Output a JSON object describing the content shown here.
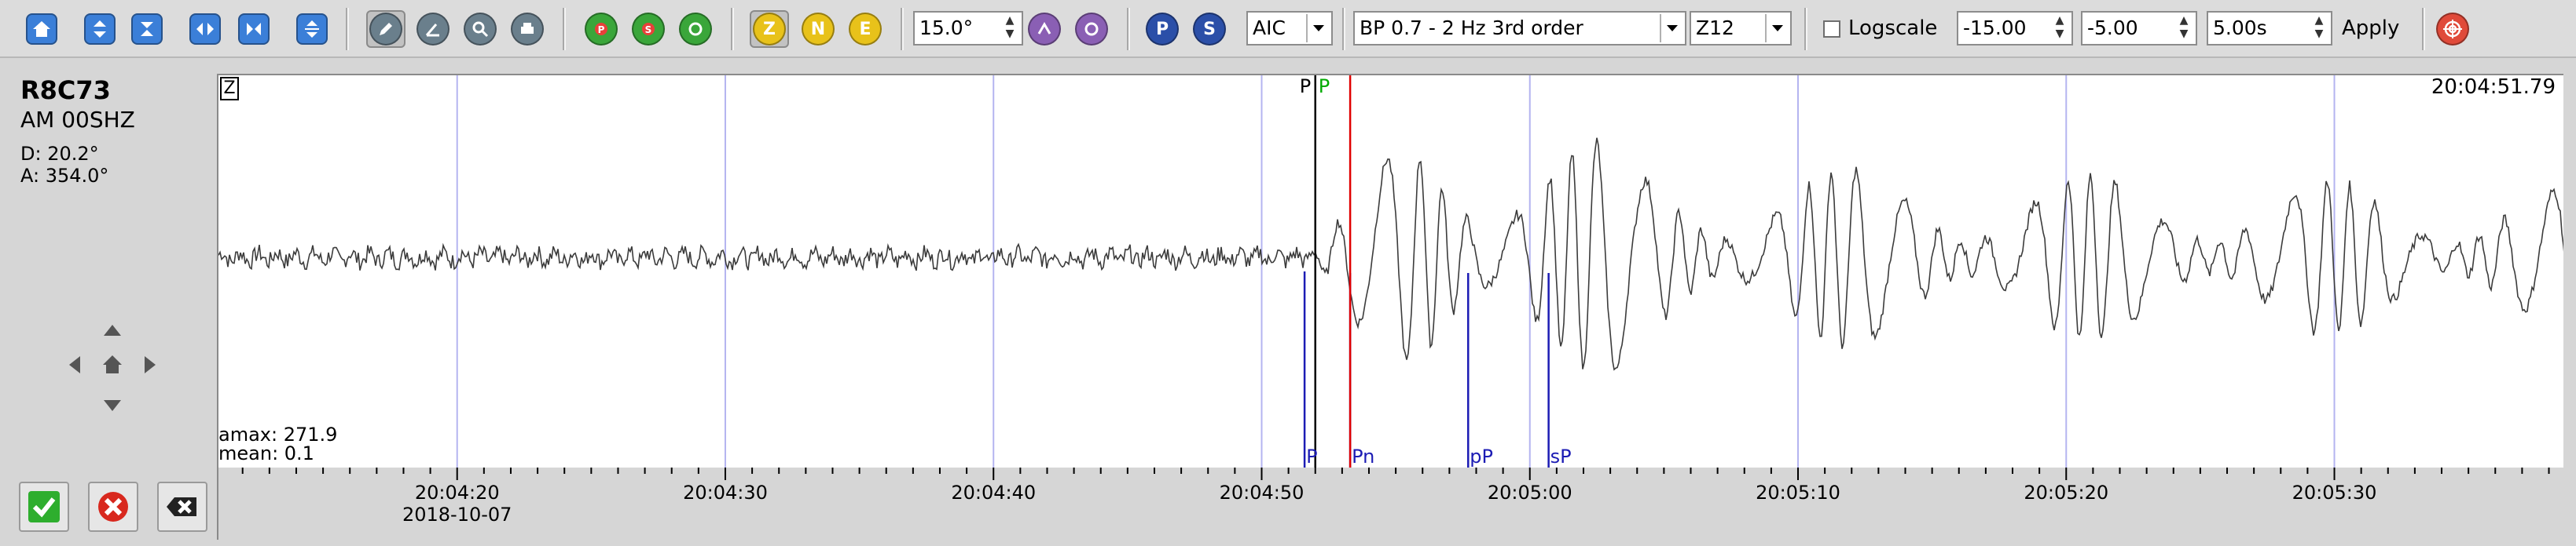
{
  "toolbar": {
    "filter_angle": "15.0°",
    "method": "AIC",
    "filter": "BP 0.7 - 2 Hz  3rd order",
    "component": "Z12",
    "logscale_label": "Logscale",
    "min_offset": "-15.00",
    "max_offset": "-5.00",
    "window_length": "5.00s",
    "apply_label": "Apply",
    "comp_z": "Z",
    "comp_n": "N",
    "comp_e": "E",
    "pick_p": "P",
    "pick_s": "S"
  },
  "station": {
    "code": "R8C73",
    "stream": "AM  00SHZ",
    "distance": "D:  20.2°",
    "azimuth": "A:  354.0°"
  },
  "trace": {
    "component_tag": "Z",
    "end_time": "20:04:51.79",
    "amax": "amax: 271.9",
    "mean": "mean: 0.1",
    "marker_top_p1": "P",
    "marker_top_p2": "P"
  },
  "picks": [
    {
      "label": "P",
      "time": 51.6
    },
    {
      "label": "Pn",
      "time": 53.3
    },
    {
      "label": "pP",
      "time": 57.7
    },
    {
      "label": "sP",
      "time": 60.7
    }
  ],
  "axis": {
    "start_seconds": 11.1,
    "end_seconds": 98.6,
    "ticks": [
      {
        "label": "20:04:20",
        "t": 20
      },
      {
        "label": "20:04:30",
        "t": 30
      },
      {
        "label": "20:04:40",
        "t": 40
      },
      {
        "label": "20:04:50",
        "t": 50
      },
      {
        "label": "20:05:00",
        "t": 60
      },
      {
        "label": "20:05:10",
        "t": 70
      },
      {
        "label": "20:05:20",
        "t": 80
      },
      {
        "label": "20:05:30",
        "t": 90
      }
    ],
    "date": "2018-10-07"
  },
  "colors": {
    "grid": "#b4b4f0",
    "pick_line": "#1c1cb4",
    "pick_text": "#1c1cb4",
    "theoretical_p": "#00aa00",
    "cursor_red": "#e00000",
    "trace": "#3c3c3c"
  }
}
